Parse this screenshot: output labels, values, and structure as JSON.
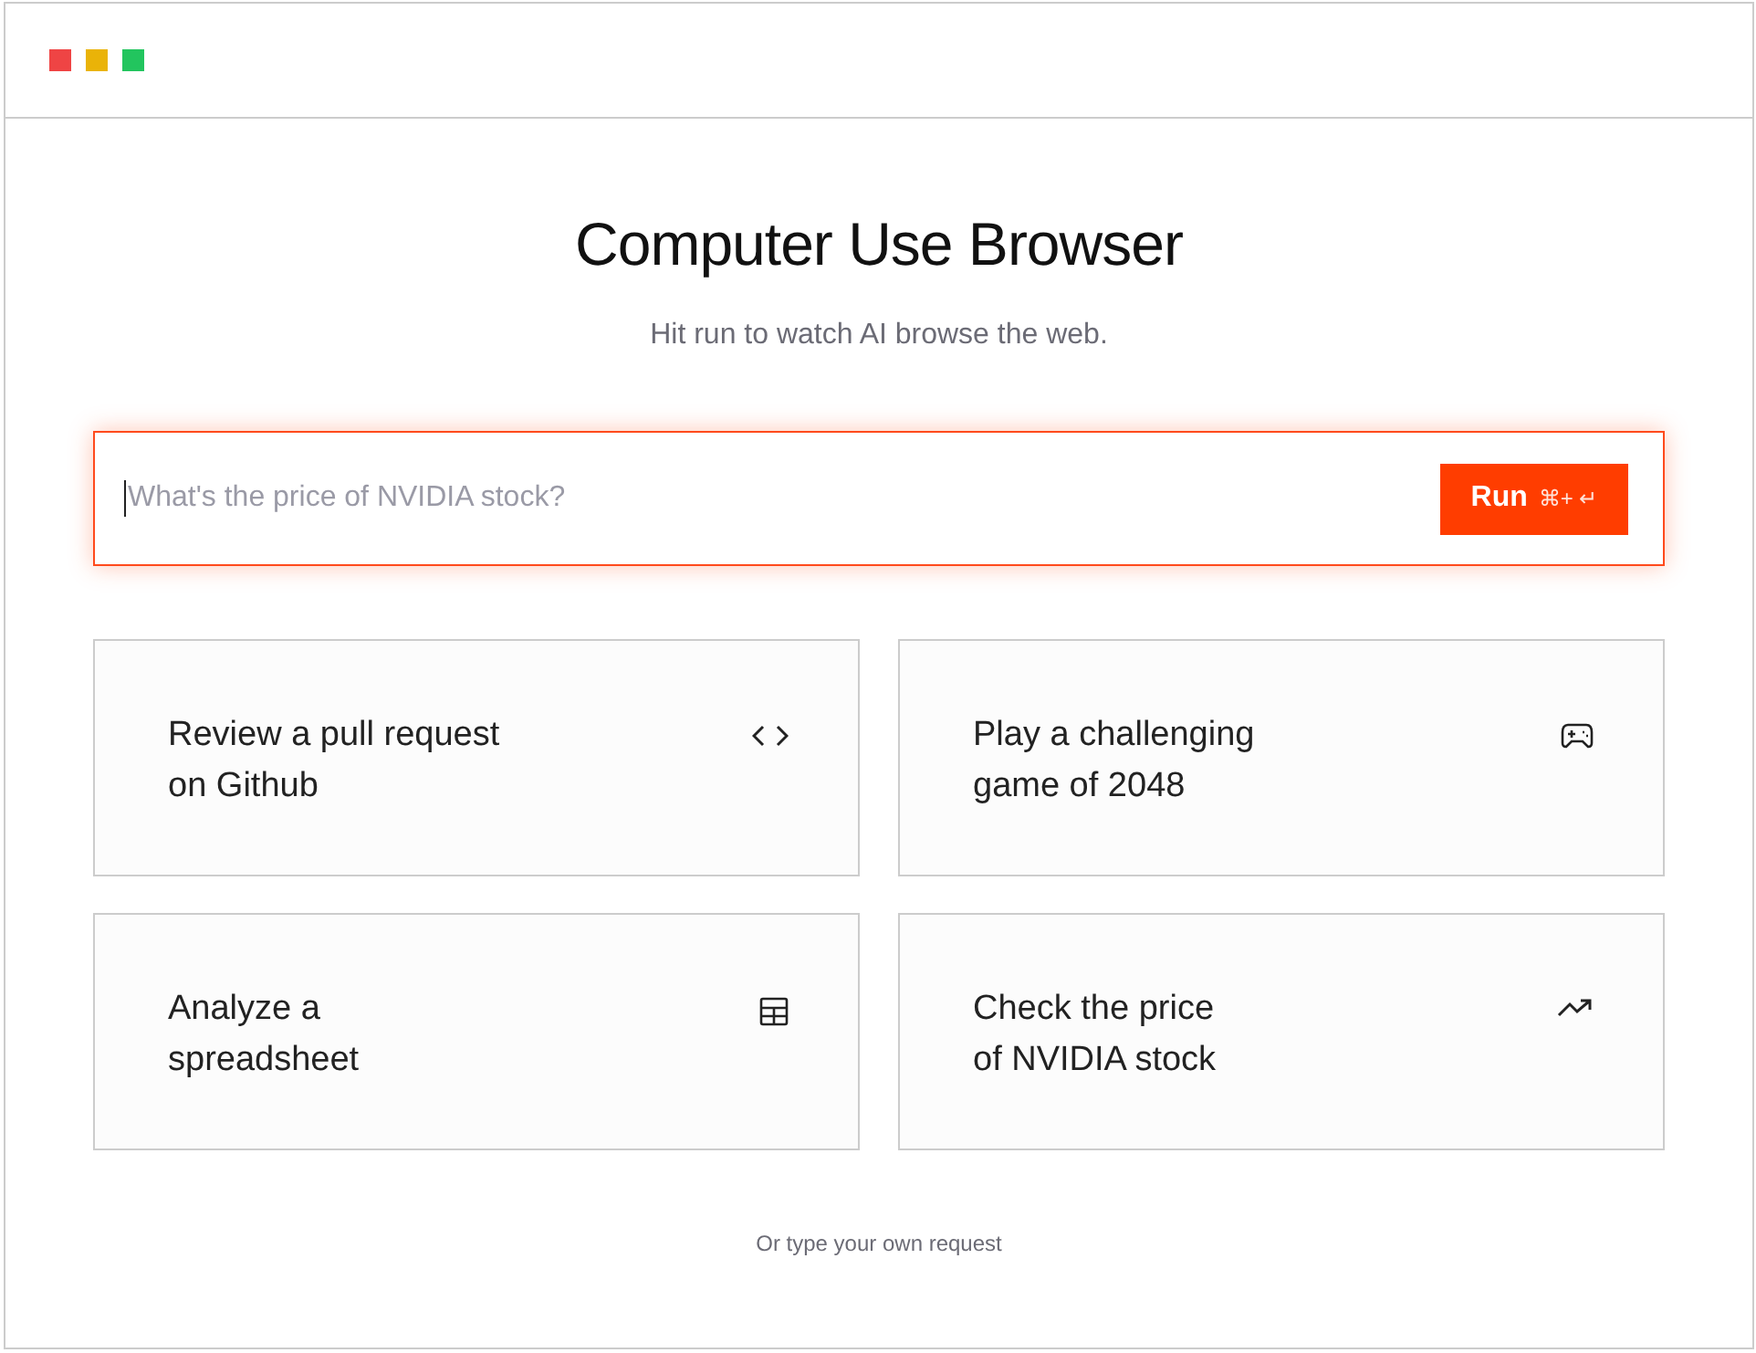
{
  "window": {
    "controls": [
      {
        "color": "#ef4444"
      },
      {
        "color": "#eab308"
      },
      {
        "color": "#22c55e"
      }
    ]
  },
  "title": "Computer Use Browser",
  "subtitle": "Hit run to watch AI browse the web.",
  "search": {
    "placeholder": "What's the price of NVIDIA stock?",
    "button": {
      "label": "Run",
      "shortcut": "⌘+ ↵"
    }
  },
  "cards": [
    {
      "text": "Review a pull request\non Github",
      "kind": "code"
    },
    {
      "text": "Play a challenging\ngame of 2048",
      "kind": "gamepad"
    },
    {
      "text": "Analyze a\nspreadsheet",
      "kind": "table"
    },
    {
      "text": "Check the price\nof NVIDIA stock",
      "kind": "trend"
    }
  ],
  "footer": "Or type your own request"
}
